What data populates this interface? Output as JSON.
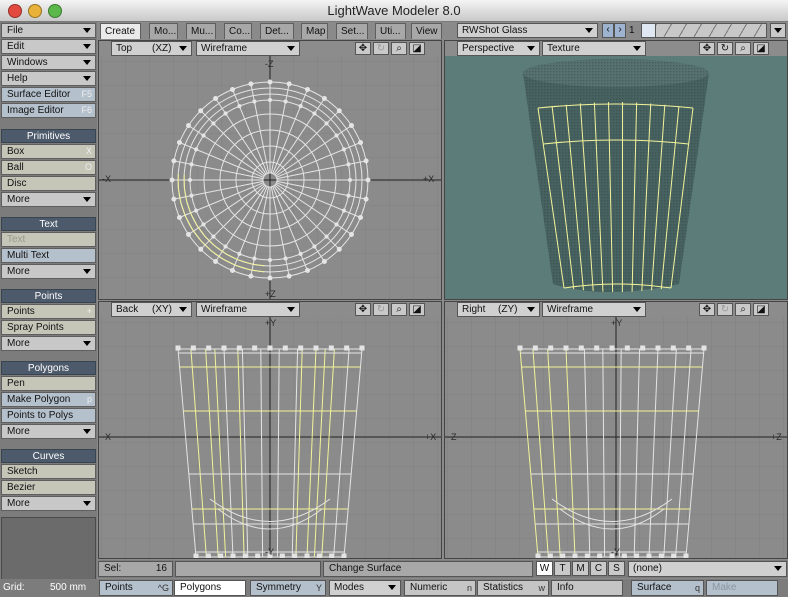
{
  "window": {
    "title": "LightWave Modeler 8.0"
  },
  "menu": [
    {
      "label": "File"
    },
    {
      "label": "Edit"
    },
    {
      "label": "Windows"
    },
    {
      "label": "Help"
    }
  ],
  "editors": [
    {
      "label": "Surface Editor",
      "key": "F5"
    },
    {
      "label": "Image Editor",
      "key": "F6"
    }
  ],
  "groups": {
    "primitives": {
      "title": "Primitives",
      "items": [
        {
          "label": "Box",
          "key": "X"
        },
        {
          "label": "Ball",
          "key": "O"
        },
        {
          "label": "Disc",
          "key": ""
        },
        {
          "label": "More",
          "key": ""
        }
      ]
    },
    "text": {
      "title": "Text",
      "items": [
        {
          "label": "Text",
          "key": ""
        },
        {
          "label": "Multi Text",
          "key": ""
        },
        {
          "label": "More",
          "key": ""
        }
      ]
    },
    "points": {
      "title": "Points",
      "items": [
        {
          "label": "Points",
          "key": "+"
        },
        {
          "label": "Spray Points",
          "key": ""
        },
        {
          "label": "More",
          "key": ""
        }
      ]
    },
    "polygons": {
      "title": "Polygons",
      "items": [
        {
          "label": "Pen",
          "key": ""
        },
        {
          "label": "Make Polygon",
          "key": "p"
        },
        {
          "label": "Points to Polys",
          "key": ""
        },
        {
          "label": "More",
          "key": ""
        }
      ]
    },
    "curves": {
      "title": "Curves",
      "items": [
        {
          "label": "Sketch",
          "key": ""
        },
        {
          "label": "Bezier",
          "key": ""
        },
        {
          "label": "More",
          "key": ""
        }
      ]
    }
  },
  "tabs": [
    "Create",
    "Mo...",
    "Mu...",
    "Co...",
    "Det...",
    "Map",
    "Set...",
    "Uti...",
    "View"
  ],
  "layer": {
    "object": "RWShot Glass",
    "layer_number": "1"
  },
  "viewports": [
    {
      "view": "Top",
      "axes": "(XZ)",
      "mode": "Wireframe",
      "labels": [
        "-Z",
        "-X",
        "+X",
        "+Z"
      ]
    },
    {
      "view": "Perspective",
      "axes": "",
      "mode": "Texture",
      "labels": []
    },
    {
      "view": "Back",
      "axes": "(XY)",
      "mode": "Wireframe",
      "labels": [
        "+Y",
        "-X",
        "+X",
        "-Y"
      ]
    },
    {
      "view": "Right",
      "axes": "(ZY)",
      "mode": "Wireframe",
      "labels": [
        "+Y",
        "-Z",
        "+Z",
        "-Y"
      ]
    }
  ],
  "status": {
    "sel_label": "Sel:",
    "sel_value": "16",
    "message": "Change Surface",
    "wtcs": [
      "W",
      "T",
      "M",
      "C",
      "S"
    ],
    "surface": "(none)"
  },
  "bottom": {
    "grid_label": "Grid:",
    "grid_value": "500 mm",
    "points": "Points",
    "points_key": "^G",
    "polygons": "Polygons",
    "symmetry": "Symmetry",
    "symmetry_key": "Y",
    "modes": "Modes",
    "numeric": "Numeric",
    "numeric_key": "n",
    "statistics": "Statistics",
    "statistics_key": "w",
    "info": "Info",
    "surface": "Surface",
    "surface_key": "q",
    "make": "Make"
  },
  "colors": {
    "selection": "#f3f39a",
    "wire": "#e4e4e4",
    "perspective_bg": "#5b7c79"
  }
}
